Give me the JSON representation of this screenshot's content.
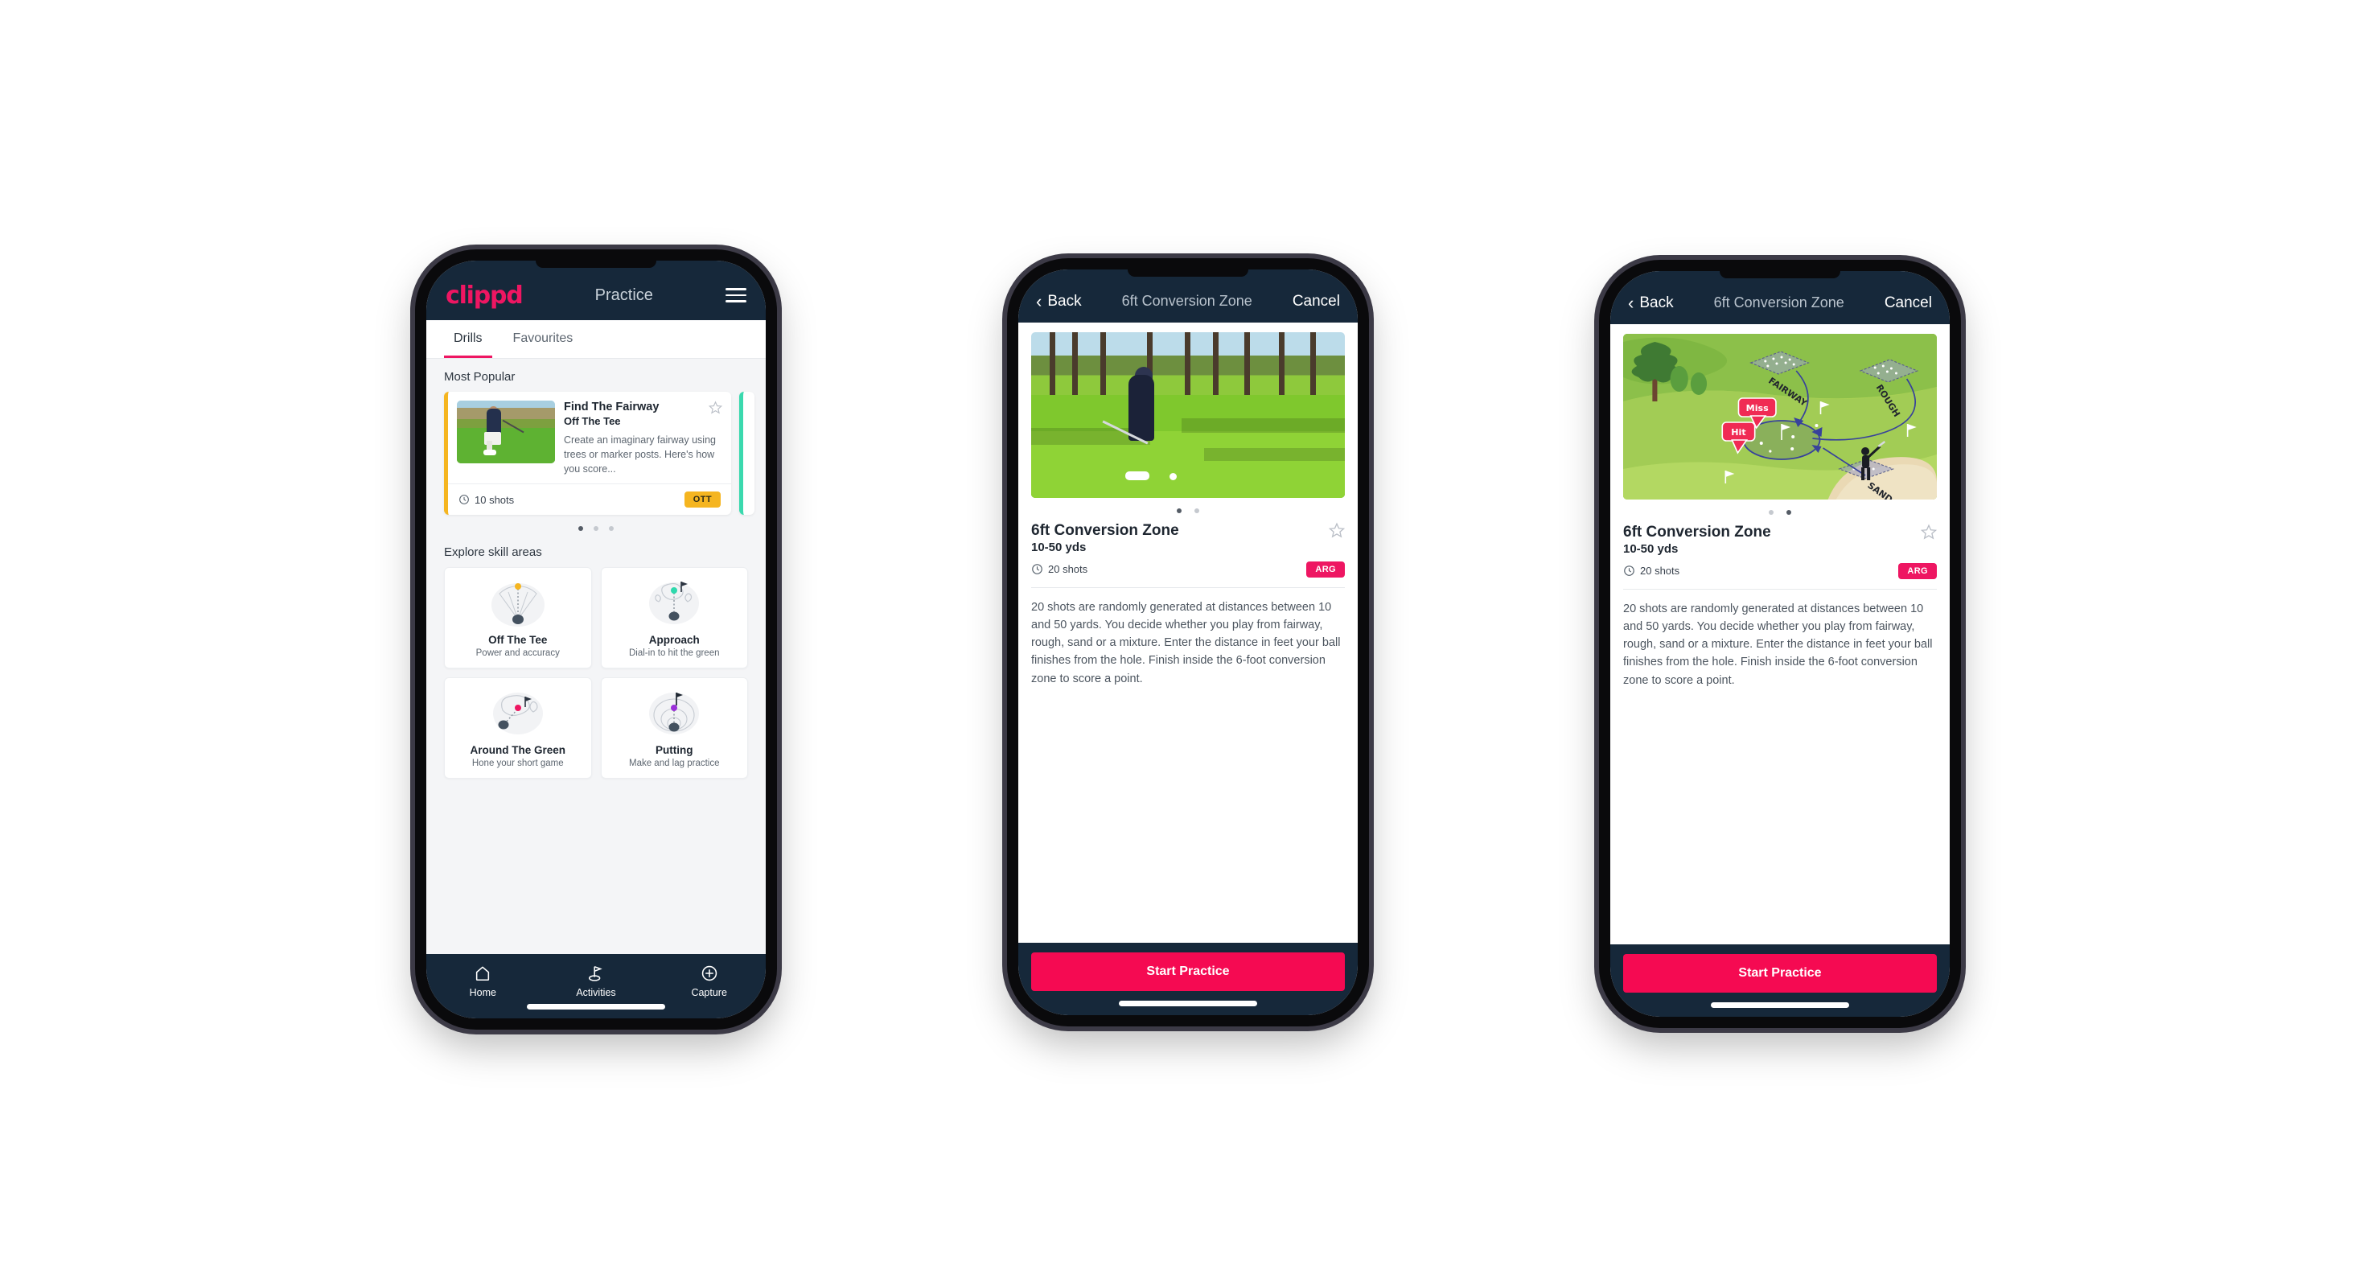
{
  "brand": {
    "accent_pink": "#ee1662",
    "accent_pink_button": "#f50a52",
    "navy": "#16283a",
    "yellow": "#f5b520",
    "teal": "#3ad9ae",
    "logo_text": "clippd"
  },
  "phone1": {
    "appbar": {
      "title": "Practice",
      "menu_icon": "hamburger-menu-icon"
    },
    "tabs": [
      {
        "label": "Drills",
        "active": true
      },
      {
        "label": "Favourites",
        "active": false
      }
    ],
    "most_popular": {
      "section_title": "Most Popular",
      "card": {
        "title": "Find The Fairway",
        "subtitle": "Off The Tee",
        "description": "Create an imaginary fairway using trees or marker posts. Here's how you score...",
        "shots": "10 shots",
        "badge": "OTT",
        "badge_color": "#f5b520",
        "favourite_icon": "star-outline-icon",
        "shots_icon": "clock-icon"
      },
      "carousel_dots": 3,
      "carousel_active": 1
    },
    "explore": {
      "section_title": "Explore skill areas",
      "skills": [
        {
          "name": "Off The Tee",
          "desc": "Power and accuracy",
          "icon": "tee-fan-icon",
          "dot_color": "#f5b520"
        },
        {
          "name": "Approach",
          "desc": "Dial-in to hit the green",
          "icon": "approach-green-icon",
          "dot_color": "#2fd9ad"
        },
        {
          "name": "Around The Green",
          "desc": "Hone your short game",
          "icon": "around-green-icon",
          "dot_color": "#ee1662"
        },
        {
          "name": "Putting",
          "desc": "Make and lag practice",
          "icon": "putting-rings-icon",
          "dot_color": "#9b30d9"
        }
      ]
    },
    "bottom_nav": [
      {
        "label": "Home",
        "icon": "home-icon",
        "active": false
      },
      {
        "label": "Activities",
        "icon": "golf-flag-icon",
        "active": true
      },
      {
        "label": "Capture",
        "icon": "plus-circle-icon",
        "active": false
      }
    ]
  },
  "phone2": {
    "navbar": {
      "back": "Back",
      "title": "6ft Conversion Zone",
      "cancel": "Cancel",
      "back_icon": "chevron-left-icon"
    },
    "hero": {
      "type": "photo",
      "alt": "golfer-pitching-photo"
    },
    "carousel_dots": 2,
    "carousel_active": 1,
    "detail": {
      "title": "6ft Conversion Zone",
      "yards": "10-50 yds",
      "shots": "20 shots",
      "badge": "ARG",
      "badge_color": "#ee1662",
      "favourite_icon": "star-outline-icon",
      "shots_icon": "clock-icon",
      "description": "20 shots are randomly generated at distances between 10 and 50 yards. You decide whether you play from fairway, rough, sand or a mixture. Enter the distance in feet your ball finishes from the hole. Finish inside the 6-foot conversion zone to score a point."
    },
    "cta": "Start Practice"
  },
  "phone3": {
    "navbar": {
      "back": "Back",
      "title": "6ft Conversion Zone",
      "cancel": "Cancel",
      "back_icon": "chevron-left-icon"
    },
    "hero": {
      "type": "illustration",
      "alt": "golf-course-diagram",
      "labels": {
        "fairway": "FAIRWAY",
        "rough": "ROUGH",
        "sand": "SAND",
        "miss": "Miss",
        "hit": "Hit"
      }
    },
    "carousel_dots": 2,
    "carousel_active": 2,
    "detail": {
      "title": "6ft Conversion Zone",
      "yards": "10-50 yds",
      "shots": "20 shots",
      "badge": "ARG",
      "badge_color": "#ee1662",
      "favourite_icon": "star-outline-icon",
      "shots_icon": "clock-icon",
      "description": "20 shots are randomly generated at distances between 10 and 50 yards. You decide whether you play from fairway, rough, sand or a mixture. Enter the distance in feet your ball finishes from the hole. Finish inside the 6-foot conversion zone to score a point."
    },
    "cta": "Start Practice"
  }
}
